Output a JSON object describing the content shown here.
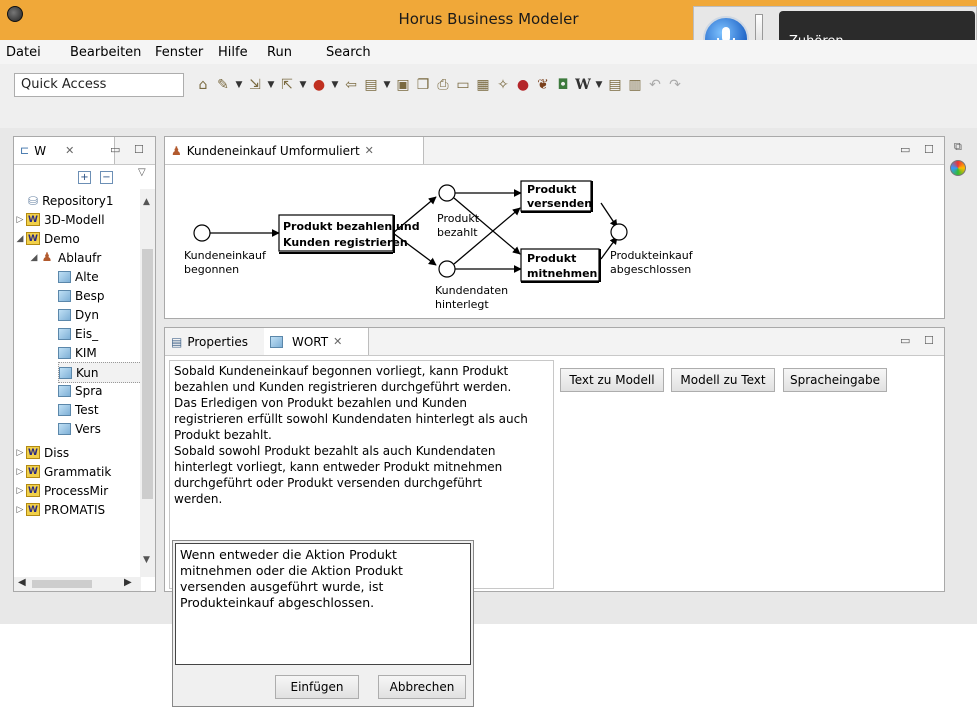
{
  "window": {
    "title": "Horus Business Modeler"
  },
  "menu": {
    "items": [
      "Datei",
      "Bearbeiten",
      "Fenster",
      "Hilfe",
      "Run",
      "Search"
    ]
  },
  "toolbar": {
    "quick_access": "Quick Access",
    "w_label": "W"
  },
  "speech": {
    "label": "Zuhören"
  },
  "repo": {
    "tab_label": "W",
    "items": [
      {
        "label": "Repository1"
      },
      {
        "label": "3D-Modell"
      },
      {
        "label": "Demo"
      },
      {
        "label": "Ablaufr"
      },
      {
        "label": "Alte"
      },
      {
        "label": "Besp"
      },
      {
        "label": "Dyn"
      },
      {
        "label": "Eis_"
      },
      {
        "label": "KIM"
      },
      {
        "label": "Kun"
      },
      {
        "label": "Spra"
      },
      {
        "label": "Test"
      },
      {
        "label": "Vers"
      },
      {
        "label": "Diss"
      },
      {
        "label": "Grammatik"
      },
      {
        "label": "ProcessMir"
      },
      {
        "label": "PROMATIS"
      }
    ]
  },
  "editor": {
    "tab_label": "Kundeneinkauf Umformuliert",
    "diagram": {
      "start_label": [
        "Kundeneinkauf",
        "begonnen"
      ],
      "task1": [
        "Produkt bezahlen und",
        "Kunden registrieren"
      ],
      "state_paid": [
        "Produkt",
        "bezahlt"
      ],
      "state_data": [
        "Kundendaten",
        "hinterlegt"
      ],
      "task_send": [
        "Produkt",
        "versenden"
      ],
      "task_take": [
        "Produkt",
        "mitnehmen"
      ],
      "end_label": [
        "Produkteinkauf",
        "abgeschlossen"
      ]
    }
  },
  "bottom": {
    "tab_properties": "Properties",
    "tab_wort": "WORT",
    "text": "Sobald Kundeneinkauf begonnen vorliegt, kann Produkt\nbezahlen und Kunden registrieren durchgeführt werden.\nDas Erledigen von Produkt bezahlen und Kunden\nregistrieren erfüllt sowohl Kundendaten hinterlegt als auch\nProdukt bezahlt.\nSobald sowohl Produkt bezahlt als auch Kundendaten\nhinterlegt vorliegt, kann entweder Produkt mitnehmen\ndurchgeführt oder Produkt versenden durchgeführt\nwerden.",
    "btn_text_to_model": "Text zu Modell",
    "btn_model_to_text": "Modell zu Text",
    "btn_speech": "Spracheingabe"
  },
  "dialog": {
    "text": "Wenn entweder die Aktion Produkt\nmitnehmen oder die Aktion Produkt\nversenden ausgeführt wurde, ist\nProdukteinkauf abgeschlossen.",
    "btn_insert": "Einfügen",
    "btn_cancel": "Abbrechen"
  },
  "colors": {
    "titlebar": "#f0a839",
    "accent": "#1f7fd4"
  }
}
